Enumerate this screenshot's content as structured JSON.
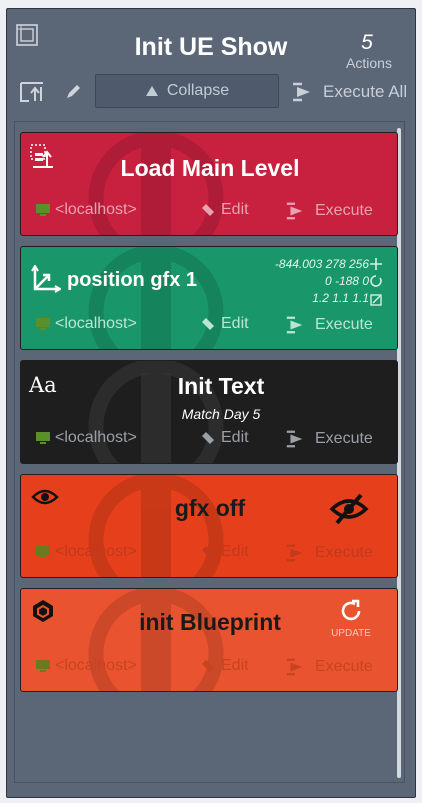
{
  "header": {
    "title": "Init UE Show",
    "action_count": "5",
    "action_count_label": "Actions",
    "collapse_label": "Collapse",
    "execute_all_label": "Execute All"
  },
  "cards": [
    {
      "name": "Load Main Level",
      "host": "<localhost>",
      "edit": "Edit",
      "execute": "Execute",
      "color": "#c8203f"
    },
    {
      "name": "position gfx 1",
      "host": "<localhost>",
      "edit": "Edit",
      "execute": "Execute",
      "color": "#19976a",
      "transform": [
        "-844.003 278 256",
        "0 -188 0",
        "1.2 1.1 1.1"
      ]
    },
    {
      "name": "Init Text",
      "subtitle": "Match Day 5",
      "icon_text": "Aa",
      "host": "<localhost>",
      "edit": "Edit",
      "execute": "Execute",
      "color": "#1e1e1e"
    },
    {
      "name": "gfx off",
      "host": "<localhost>",
      "edit": "Edit",
      "execute": "Execute",
      "color": "#e5401b"
    },
    {
      "name": "init Blueprint",
      "update_label": "UPDATE",
      "host": "<localhost>",
      "edit": "Edit",
      "execute": "Execute",
      "color": "#e9532f"
    }
  ],
  "icons": [
    "grid-frame-icon",
    "collapse-panel-icon",
    "pencil-icon",
    "triangle-up-icon",
    "execute-icon",
    "load-level-icon",
    "transform-axes-icon",
    "eye-icon",
    "eye-slash-icon",
    "blueprint-icon",
    "refresh-icon",
    "monitor-icon",
    "move-icon",
    "rotate-icon",
    "scale-icon"
  ]
}
